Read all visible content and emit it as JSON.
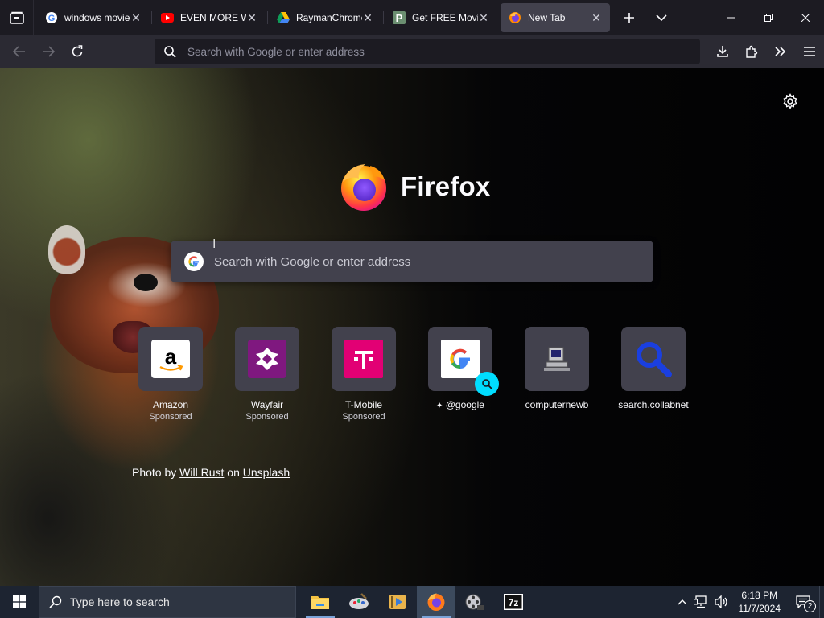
{
  "tabs": [
    {
      "title": "windows movie",
      "icon": "google-icon",
      "active": false
    },
    {
      "title": "EVEN MORE WM",
      "icon": "youtube-icon",
      "active": false
    },
    {
      "title": "RaymanChrome",
      "icon": "google-drive-icon",
      "active": false
    },
    {
      "title": "Get FREE Movie",
      "icon": "p-site-icon",
      "active": false
    },
    {
      "title": "New Tab",
      "icon": "firefox-icon",
      "active": true
    }
  ],
  "urlbar": {
    "placeholder": "Search with Google or enter address"
  },
  "newtab": {
    "brand": "Firefox",
    "search_placeholder": "Search with Google or enter address",
    "tiles": [
      {
        "label": "Amazon",
        "sub": "Sponsored",
        "icon": "amazon-icon"
      },
      {
        "label": "Wayfair",
        "sub": "Sponsored",
        "icon": "wayfair-icon"
      },
      {
        "label": "T-Mobile",
        "sub": "Sponsored",
        "icon": "tmobile-icon"
      },
      {
        "label": "@google",
        "sub": "",
        "icon": "google-icon",
        "pinned_search": true
      },
      {
        "label": "computernewb",
        "sub": "",
        "icon": "computer-icon"
      },
      {
        "label": "search.collabnet",
        "sub": "",
        "icon": "magnifier-icon"
      }
    ],
    "credit": {
      "prefix": "Photo by",
      "author": "Will Rust",
      "on": "on",
      "source": "Unsplash"
    }
  },
  "taskbar": {
    "search_placeholder": "Type here to search",
    "time": "6:18 PM",
    "date": "11/7/2024",
    "notifications": "2"
  },
  "colors": {
    "accent": "#00ddff",
    "tabstrip": "#1c1b22",
    "toolbar": "#2b2a33",
    "taskbar": "#1d2431"
  }
}
